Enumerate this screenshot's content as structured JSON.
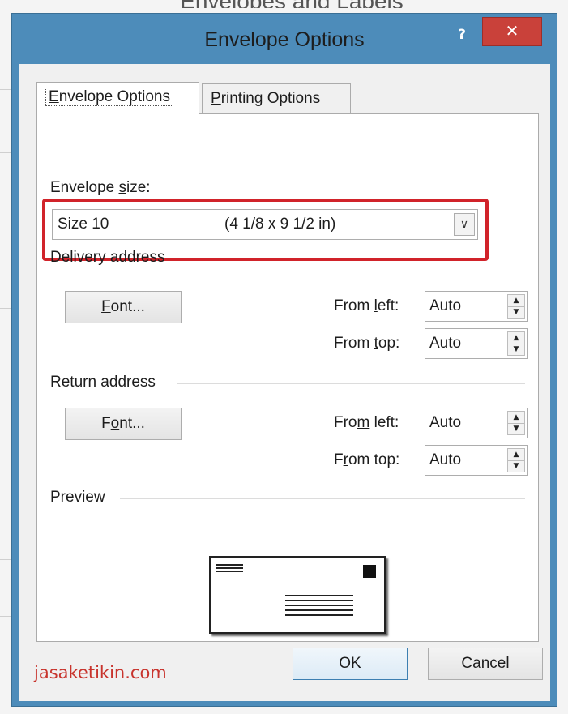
{
  "background": {
    "document_title": "Envelopes and Labels"
  },
  "dialog": {
    "title": "Envelope Options",
    "help_label": "?",
    "close_label": "✕",
    "tabs": [
      {
        "label_pre": "",
        "label_u": "E",
        "label_post": "nvelope Options"
      },
      {
        "label_pre": "",
        "label_u": "P",
        "label_post": "rinting Options"
      }
    ],
    "envelope_size": {
      "label_pre": "Envelope ",
      "label_u": "s",
      "label_post": "ize:",
      "selected_name": "Size 10",
      "selected_dims": "(4 1/8 x 9 1/2 in)"
    },
    "delivery": {
      "heading": "Delivery address",
      "font_btn_pre": "",
      "font_btn_u": "F",
      "font_btn_post": "ont...",
      "from_left_pre": "From ",
      "from_left_u": "l",
      "from_left_post": "eft:",
      "from_left_value": "Auto",
      "from_top_pre": "From ",
      "from_top_u": "t",
      "from_top_post": "op:",
      "from_top_value": "Auto"
    },
    "return": {
      "heading": "Return address",
      "font_btn_pre": "F",
      "font_btn_u": "o",
      "font_btn_post": "nt...",
      "from_left_pre": "Fro",
      "from_left_u": "m",
      "from_left_post": " left:",
      "from_left_value": "Auto",
      "from_top_pre": "F",
      "from_top_u": "r",
      "from_top_post": "om top:",
      "from_top_value": "Auto"
    },
    "preview_heading": "Preview",
    "ok_label": "OK",
    "cancel_label": "Cancel"
  },
  "watermark": "jasaketikin.com",
  "colors": {
    "highlight": "#d1232a",
    "titlebar": "#4d8cba",
    "close_button": "#c9413a",
    "watermark": "#c8342d"
  }
}
